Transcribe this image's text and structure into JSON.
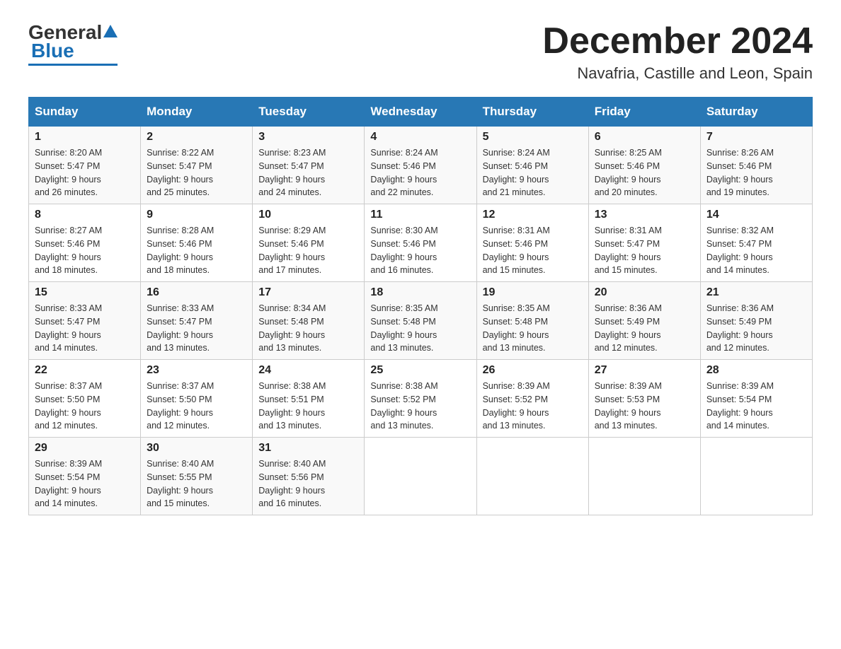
{
  "logo": {
    "general": "General",
    "blue": "Blue"
  },
  "header": {
    "month": "December 2024",
    "location": "Navafria, Castille and Leon, Spain"
  },
  "days_of_week": [
    "Sunday",
    "Monday",
    "Tuesday",
    "Wednesday",
    "Thursday",
    "Friday",
    "Saturday"
  ],
  "weeks": [
    [
      {
        "day": "1",
        "sunrise": "8:20 AM",
        "sunset": "5:47 PM",
        "daylight": "9 hours and 26 minutes."
      },
      {
        "day": "2",
        "sunrise": "8:22 AM",
        "sunset": "5:47 PM",
        "daylight": "9 hours and 25 minutes."
      },
      {
        "day": "3",
        "sunrise": "8:23 AM",
        "sunset": "5:47 PM",
        "daylight": "9 hours and 24 minutes."
      },
      {
        "day": "4",
        "sunrise": "8:24 AM",
        "sunset": "5:46 PM",
        "daylight": "9 hours and 22 minutes."
      },
      {
        "day": "5",
        "sunrise": "8:24 AM",
        "sunset": "5:46 PM",
        "daylight": "9 hours and 21 minutes."
      },
      {
        "day": "6",
        "sunrise": "8:25 AM",
        "sunset": "5:46 PM",
        "daylight": "9 hours and 20 minutes."
      },
      {
        "day": "7",
        "sunrise": "8:26 AM",
        "sunset": "5:46 PM",
        "daylight": "9 hours and 19 minutes."
      }
    ],
    [
      {
        "day": "8",
        "sunrise": "8:27 AM",
        "sunset": "5:46 PM",
        "daylight": "9 hours and 18 minutes."
      },
      {
        "day": "9",
        "sunrise": "8:28 AM",
        "sunset": "5:46 PM",
        "daylight": "9 hours and 18 minutes."
      },
      {
        "day": "10",
        "sunrise": "8:29 AM",
        "sunset": "5:46 PM",
        "daylight": "9 hours and 17 minutes."
      },
      {
        "day": "11",
        "sunrise": "8:30 AM",
        "sunset": "5:46 PM",
        "daylight": "9 hours and 16 minutes."
      },
      {
        "day": "12",
        "sunrise": "8:31 AM",
        "sunset": "5:46 PM",
        "daylight": "9 hours and 15 minutes."
      },
      {
        "day": "13",
        "sunrise": "8:31 AM",
        "sunset": "5:47 PM",
        "daylight": "9 hours and 15 minutes."
      },
      {
        "day": "14",
        "sunrise": "8:32 AM",
        "sunset": "5:47 PM",
        "daylight": "9 hours and 14 minutes."
      }
    ],
    [
      {
        "day": "15",
        "sunrise": "8:33 AM",
        "sunset": "5:47 PM",
        "daylight": "9 hours and 14 minutes."
      },
      {
        "day": "16",
        "sunrise": "8:33 AM",
        "sunset": "5:47 PM",
        "daylight": "9 hours and 13 minutes."
      },
      {
        "day": "17",
        "sunrise": "8:34 AM",
        "sunset": "5:48 PM",
        "daylight": "9 hours and 13 minutes."
      },
      {
        "day": "18",
        "sunrise": "8:35 AM",
        "sunset": "5:48 PM",
        "daylight": "9 hours and 13 minutes."
      },
      {
        "day": "19",
        "sunrise": "8:35 AM",
        "sunset": "5:48 PM",
        "daylight": "9 hours and 13 minutes."
      },
      {
        "day": "20",
        "sunrise": "8:36 AM",
        "sunset": "5:49 PM",
        "daylight": "9 hours and 12 minutes."
      },
      {
        "day": "21",
        "sunrise": "8:36 AM",
        "sunset": "5:49 PM",
        "daylight": "9 hours and 12 minutes."
      }
    ],
    [
      {
        "day": "22",
        "sunrise": "8:37 AM",
        "sunset": "5:50 PM",
        "daylight": "9 hours and 12 minutes."
      },
      {
        "day": "23",
        "sunrise": "8:37 AM",
        "sunset": "5:50 PM",
        "daylight": "9 hours and 12 minutes."
      },
      {
        "day": "24",
        "sunrise": "8:38 AM",
        "sunset": "5:51 PM",
        "daylight": "9 hours and 13 minutes."
      },
      {
        "day": "25",
        "sunrise": "8:38 AM",
        "sunset": "5:52 PM",
        "daylight": "9 hours and 13 minutes."
      },
      {
        "day": "26",
        "sunrise": "8:39 AM",
        "sunset": "5:52 PM",
        "daylight": "9 hours and 13 minutes."
      },
      {
        "day": "27",
        "sunrise": "8:39 AM",
        "sunset": "5:53 PM",
        "daylight": "9 hours and 13 minutes."
      },
      {
        "day": "28",
        "sunrise": "8:39 AM",
        "sunset": "5:54 PM",
        "daylight": "9 hours and 14 minutes."
      }
    ],
    [
      {
        "day": "29",
        "sunrise": "8:39 AM",
        "sunset": "5:54 PM",
        "daylight": "9 hours and 14 minutes."
      },
      {
        "day": "30",
        "sunrise": "8:40 AM",
        "sunset": "5:55 PM",
        "daylight": "9 hours and 15 minutes."
      },
      {
        "day": "31",
        "sunrise": "8:40 AM",
        "sunset": "5:56 PM",
        "daylight": "9 hours and 16 minutes."
      },
      null,
      null,
      null,
      null
    ]
  ],
  "labels": {
    "sunrise": "Sunrise:",
    "sunset": "Sunset:",
    "daylight": "Daylight:"
  }
}
